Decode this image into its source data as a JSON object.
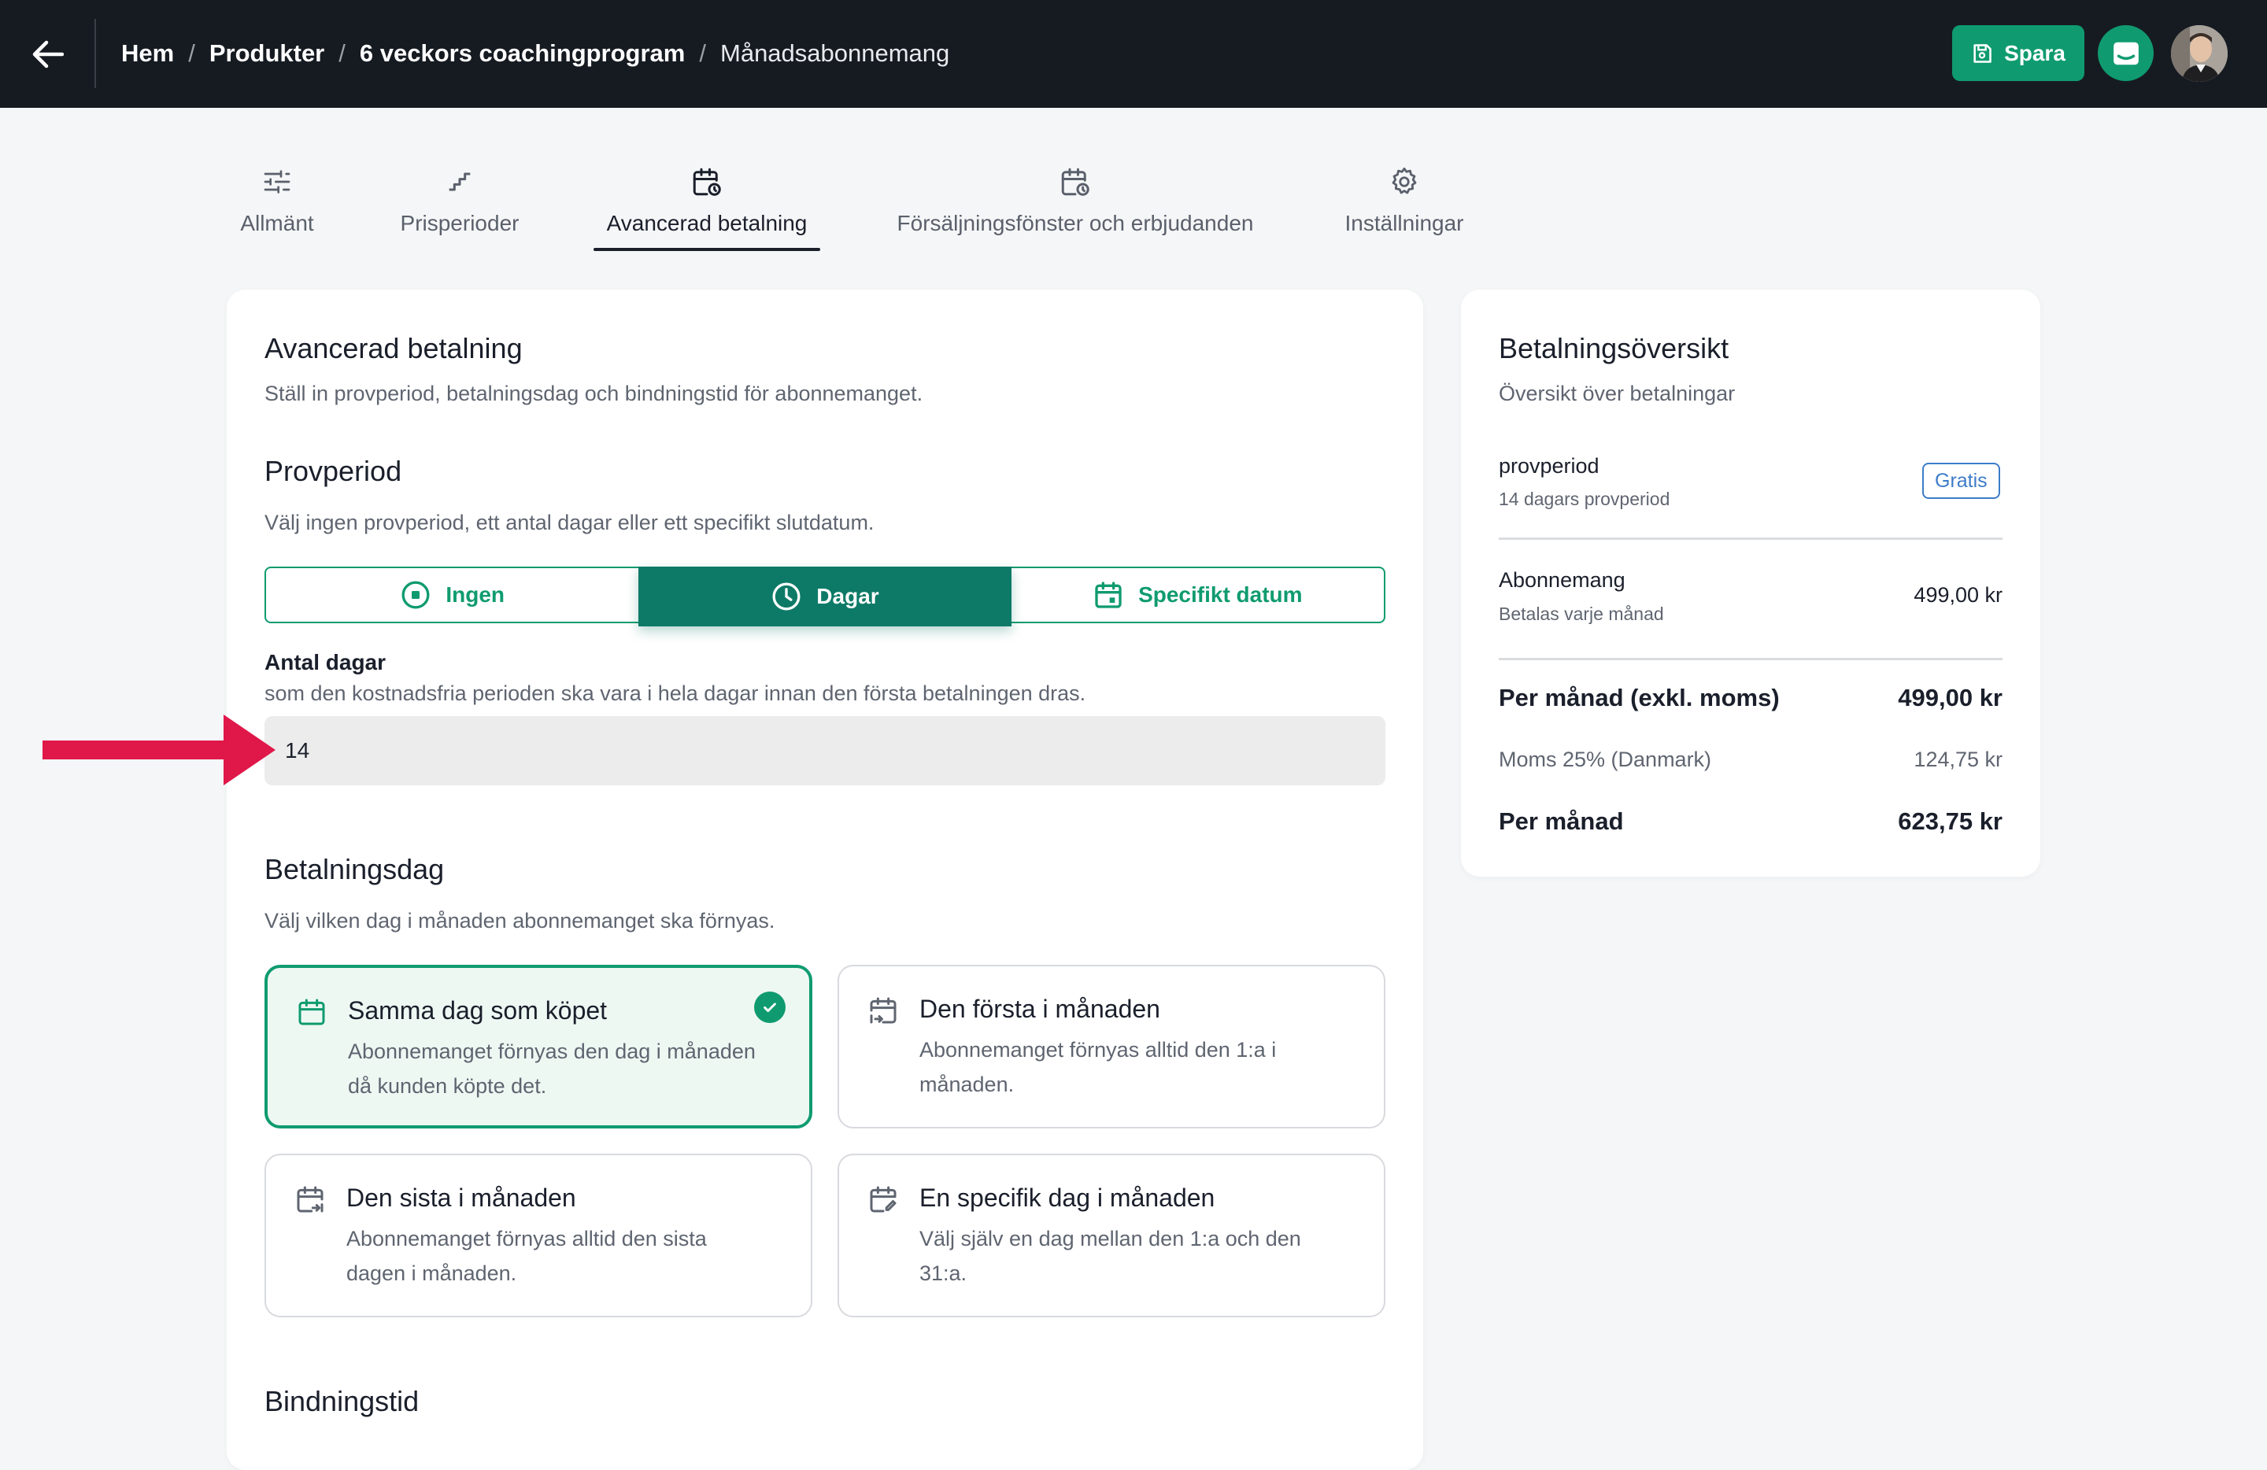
{
  "breadcrumb": [
    "Hem",
    "Produkter",
    "6 veckors coachingprogram",
    "Månadsabonnemang"
  ],
  "header": {
    "save_label": "Spara"
  },
  "tabs": [
    {
      "label": "Allmänt",
      "icon": "sliders-icon"
    },
    {
      "label": "Prisperioder",
      "icon": "stairs-icon"
    },
    {
      "label": "Avancerad betalning",
      "icon": "calendar-clock-icon",
      "active": true
    },
    {
      "label": "Försäljningsfönster och erbjudanden",
      "icon": "calendar-clock-icon"
    },
    {
      "label": "Inställningar",
      "icon": "gear-icon"
    }
  ],
  "main": {
    "title": "Avancerad betalning",
    "subtitle": "Ställ in provperiod, betalningsdag och bindningstid för abonnemanget.",
    "trial": {
      "title": "Provperiod",
      "subtitle": "Välj ingen provperiod, ett antal dagar eller ett specifikt slutdatum.",
      "options": [
        "Ingen",
        "Dagar",
        "Specifikt datum"
      ],
      "selected": "Dagar",
      "days_label": "Antal dagar",
      "days_help": "som den kostnadsfria perioden ska vara i hela dagar innan den första betalningen dras.",
      "days_value": "14"
    },
    "payment_day": {
      "title": "Betalningsdag",
      "subtitle": "Välj vilken dag i månaden abonnemanget ska förnyas.",
      "options": [
        {
          "title": "Samma dag som köpet",
          "desc": "Abonnemanget förnyas den dag i månaden då kunden köpte det.",
          "selected": true
        },
        {
          "title": "Den första i månaden",
          "desc": "Abonnemanget förnyas alltid den 1:a i månaden.",
          "selected": false
        },
        {
          "title": "Den sista i månaden",
          "desc": "Abonnemanget förnyas alltid den sista dagen i månaden.",
          "selected": false
        },
        {
          "title": "En specifik dag i månaden",
          "desc": "Välj själv en dag mellan den 1:a och den 31:a.",
          "selected": false
        }
      ]
    },
    "binding": {
      "title": "Bindningstid"
    }
  },
  "overview": {
    "title": "Betalningsöversikt",
    "subtitle": "Översikt över betalningar",
    "trial_title": "provperiod",
    "trial_sub": "14 dagars provperiod",
    "trial_badge": "Gratis",
    "sub_title": "Abonnemang",
    "sub_sub": "Betalas varje månad",
    "sub_amount": "499,00 kr",
    "excl_label": "Per månad (exkl. moms)",
    "excl_amount": "499,00 kr",
    "vat_label": "Moms 25% (Danmark)",
    "vat_amount": "124,75 kr",
    "total_label": "Per månad",
    "total_amount": "623,75 kr"
  },
  "colors": {
    "accent": "#0f9b6f",
    "accent_dark": "#0d7a67",
    "header_bg": "#161b22",
    "arrow": "#e0184a",
    "badge": "#3d7cc9"
  }
}
